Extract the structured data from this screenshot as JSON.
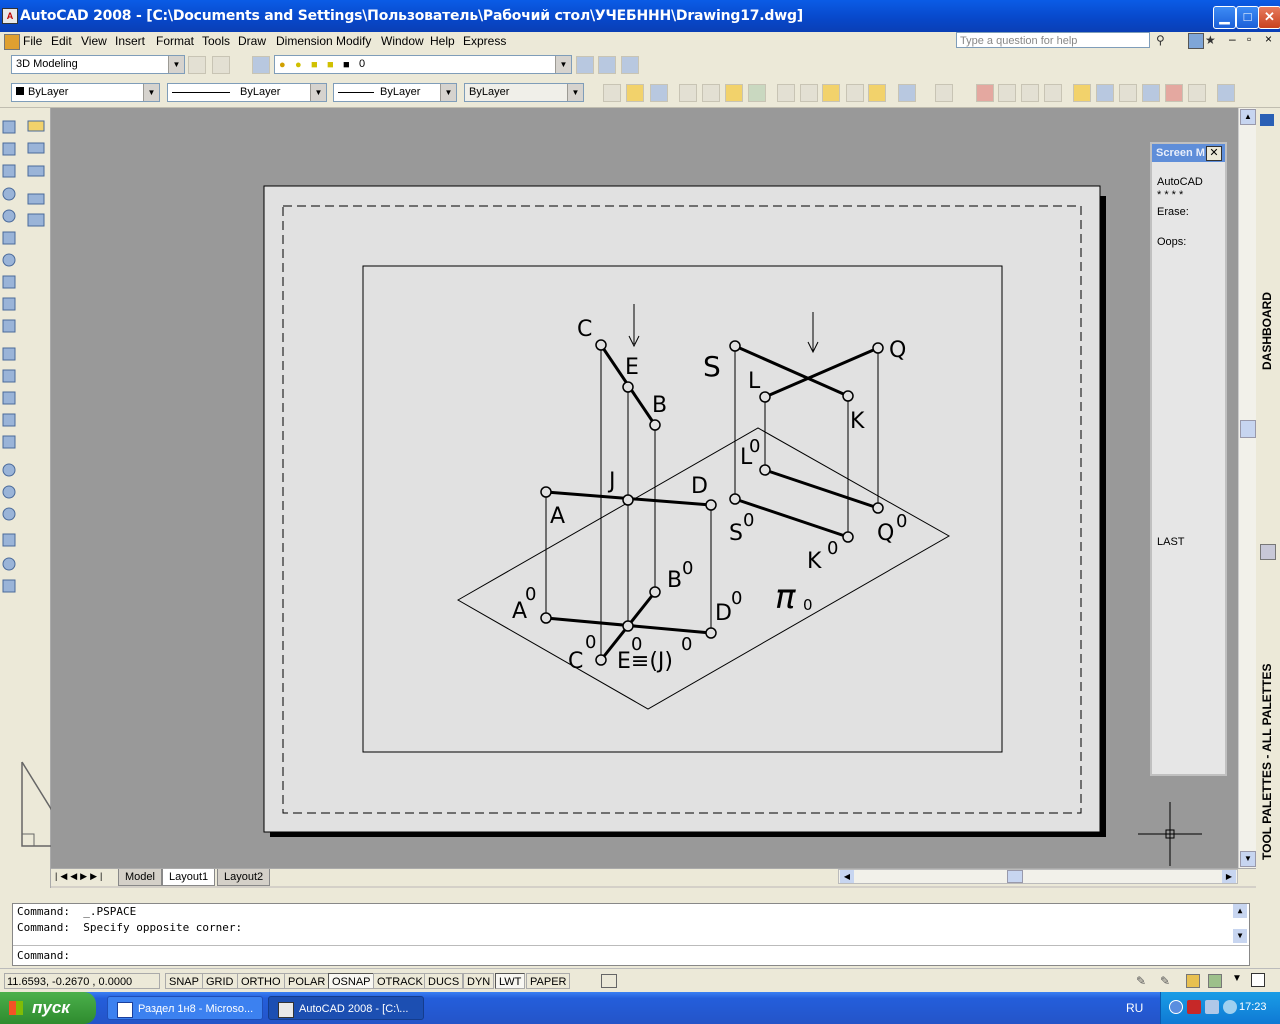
{
  "window": {
    "title": "AutoCAD 2008 - [C:\\Documents and Settings\\Пользователь\\Рабочий стол\\УЧЕБННН\\Drawing17.dwg]",
    "minimize": "▁",
    "maximize": "□",
    "close": "✕"
  },
  "menubar": {
    "items": [
      "File",
      "Edit",
      "View",
      "Insert",
      "Format",
      "Tools",
      "Draw",
      "Dimension",
      "Modify",
      "Window",
      "Help",
      "Express"
    ],
    "help_placeholder": "Type a question for help"
  },
  "toolbar": {
    "workspace": "3D Modeling",
    "layer": "0",
    "color": "ByLayer",
    "linetype": "ByLayer",
    "lineweight": "ByLayer",
    "plotstyle": "ByLayer"
  },
  "tabs": [
    "Model",
    "Layout1",
    "Layout2"
  ],
  "active_tab": "Layout1",
  "screen_menu": {
    "title": "Screen M",
    "items": [
      "AutoCAD",
      "* * * *",
      "Erase:",
      "Oops:",
      "LAST"
    ]
  },
  "right_strip": {
    "dashboard": "DASHBOARD",
    "tool_palettes": "TOOL PALETTES - ALL PALETTES"
  },
  "drawing": {
    "labels": {
      "C": "C",
      "E": "E",
      "B": "B",
      "J": "J",
      "D": "D",
      "A": "A",
      "S": "S",
      "L": "L",
      "K": "K",
      "Q": "Q",
      "L0": "L",
      "S0": "S",
      "K0": "K",
      "Q0": "Q",
      "A0": "A",
      "B0": "B",
      "D0": "D",
      "C0": "C",
      "E0J": "E≡(J)",
      "zero": "0",
      "pi": "π",
      "pi_sub": "0"
    }
  },
  "command": {
    "line1": "Command:  _.PSPACE",
    "line2": "Command:  Specify opposite corner:",
    "prompt": "Command:"
  },
  "status": {
    "coords": "11.6593, -0.2670 , 0.0000",
    "buttons": [
      "SNAP",
      "GRID",
      "ORTHO",
      "POLAR",
      "OSNAP",
      "OTRACK",
      "DUCS",
      "DYN",
      "LWT",
      "PAPER"
    ],
    "on": [
      "OSNAP",
      "LWT"
    ]
  },
  "taskbar": {
    "start": "пуск",
    "items": [
      "Раздел 1н8 - Microso...",
      "AutoCAD 2008 - [C:\\..."
    ],
    "lang": "RU",
    "time": "17:23"
  }
}
